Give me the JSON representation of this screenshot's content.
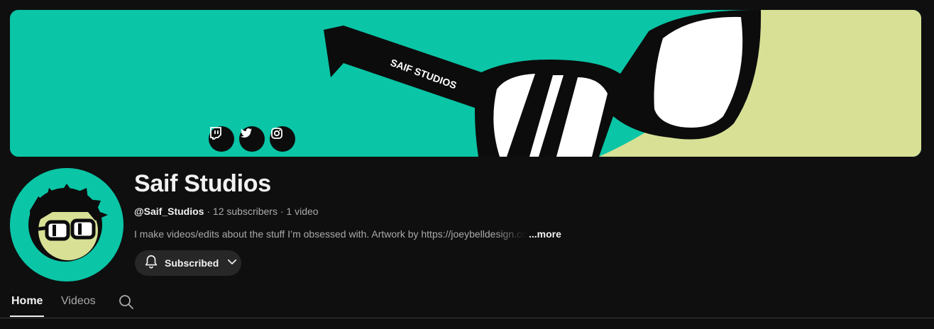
{
  "banner": {
    "glasses_text": "SAIF STUDIOS",
    "colors": {
      "teal": "#0ac5a6",
      "yellow": "#d8e095",
      "black": "#0c0c0c"
    },
    "social_icons": [
      "twitch-icon",
      "twitter-icon",
      "instagram-icon"
    ]
  },
  "channel": {
    "name": "Saif Studios",
    "handle": "@Saif_Studios",
    "separator": " · ",
    "subscribers": "12 subscribers",
    "videos": "1 video",
    "description": "I make videos/edits about the stuff I’m obsessed with. Artwork by https://joeybelldesign.com",
    "more_label": "...more"
  },
  "subscribe_button": {
    "label": "Subscribed",
    "icon": "bell-icon",
    "chevron": "chevron-down-icon"
  },
  "tabs": [
    {
      "label": "Home",
      "active": true
    },
    {
      "label": "Videos",
      "active": false
    }
  ],
  "tab_search_icon": "search-icon"
}
